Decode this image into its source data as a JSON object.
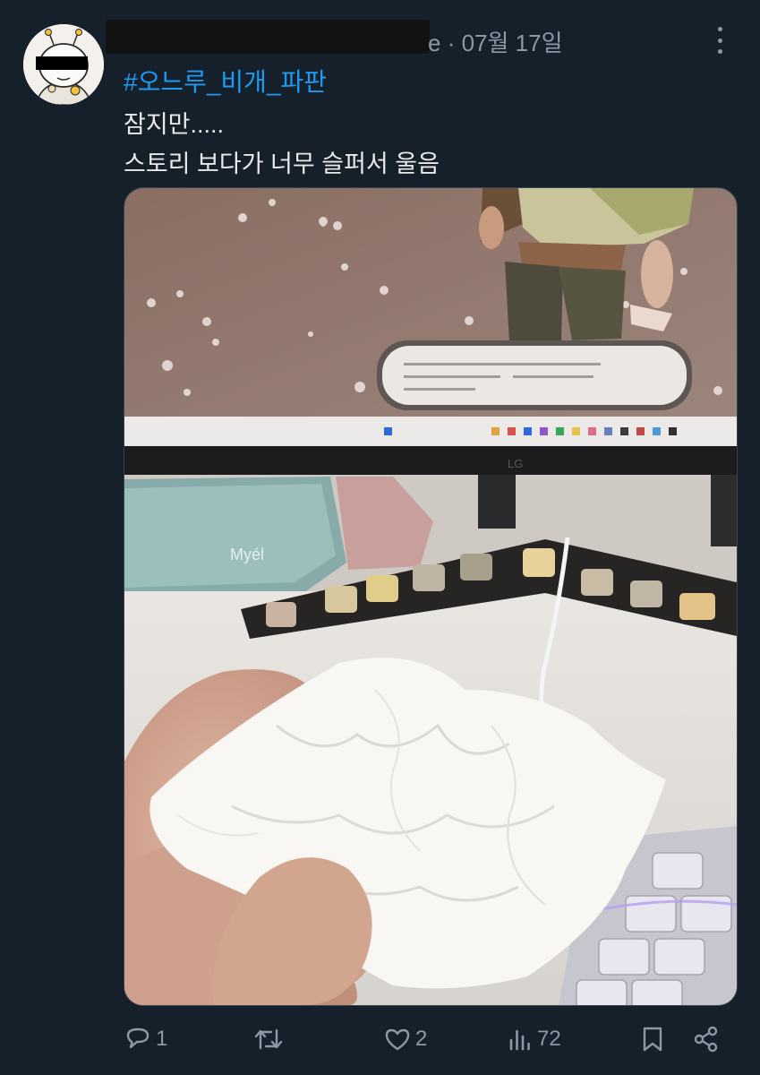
{
  "tweet": {
    "handle_tail": "e",
    "separator": "·",
    "date": "07월 17일",
    "hashtag": "#오느루_비개_파판",
    "text_line1": "잠지만.....",
    "text_line2": "스토리 보다가 너무 슬퍼서 울음"
  },
  "stats": {
    "replies": "1",
    "retweets": "",
    "likes": "2",
    "views": "72"
  },
  "icons": {
    "more": "more-vertical-icon",
    "reply": "reply-icon",
    "retweet": "retweet-icon",
    "like": "heart-icon",
    "views": "views-icon",
    "bookmark": "bookmark-icon",
    "share": "share-icon"
  },
  "colors": {
    "background": "#15202b",
    "text": "#e7e9ea",
    "muted": "#8b98a5",
    "link": "#1d9bf0"
  }
}
